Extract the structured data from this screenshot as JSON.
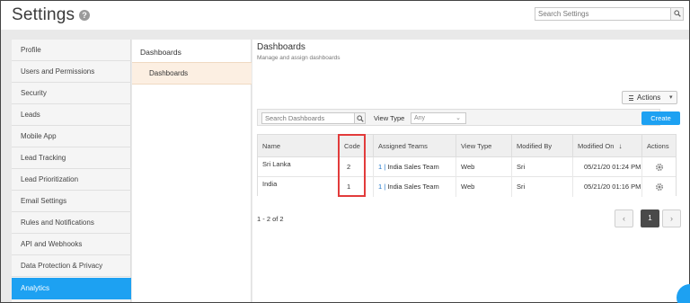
{
  "header": {
    "title": "Settings",
    "help_icon": "help-circle-icon",
    "search_placeholder": "Search Settings"
  },
  "sidebar": {
    "items": [
      {
        "label": "Profile"
      },
      {
        "label": "Users and Permissions"
      },
      {
        "label": "Security"
      },
      {
        "label": "Leads"
      },
      {
        "label": "Mobile App"
      },
      {
        "label": "Lead Tracking"
      },
      {
        "label": "Lead Prioritization"
      },
      {
        "label": "Email Settings"
      },
      {
        "label": "Rules and Notifications"
      },
      {
        "label": "API and Webhooks"
      },
      {
        "label": "Data Protection & Privacy"
      },
      {
        "label": "Analytics",
        "active": true
      }
    ],
    "active_color": "#1da1f2"
  },
  "subnav": {
    "heading": "Dashboards",
    "item": "Dashboards"
  },
  "main": {
    "title": "Dashboards",
    "subtitle": "Manage and assign dashboards",
    "actions_label": "Actions",
    "search_placeholder": "Search Dashboards",
    "view_type_label": "View Type",
    "view_type_value": "Any",
    "create_label": "Create",
    "columns": [
      "Name",
      "Code",
      "Assigned Teams",
      "View Type",
      "Modified By",
      "Modified On",
      "Actions"
    ],
    "rows": [
      {
        "name": "Sri Lanka",
        "code": "2",
        "team_id": "1",
        "team_sep": "|",
        "team_name": "India Sales Team",
        "view_type": "Web",
        "modified_by": "Sri",
        "modified_on": "05/21/20 01:24 PM"
      },
      {
        "name": "India",
        "code": "1",
        "team_id": "1",
        "team_sep": "|",
        "team_name": "India Sales Team",
        "view_type": "Web",
        "modified_by": "Sri",
        "modified_on": "05/21/20 01:16 PM"
      }
    ],
    "record_count": "1 - 2 of 2",
    "page": {
      "prev": "‹",
      "current": "1",
      "next": "›"
    }
  },
  "colors": {
    "accent": "#1da1f2",
    "highlight": "#e23b3b",
    "subnav_active_bg": "#fcefe2"
  }
}
